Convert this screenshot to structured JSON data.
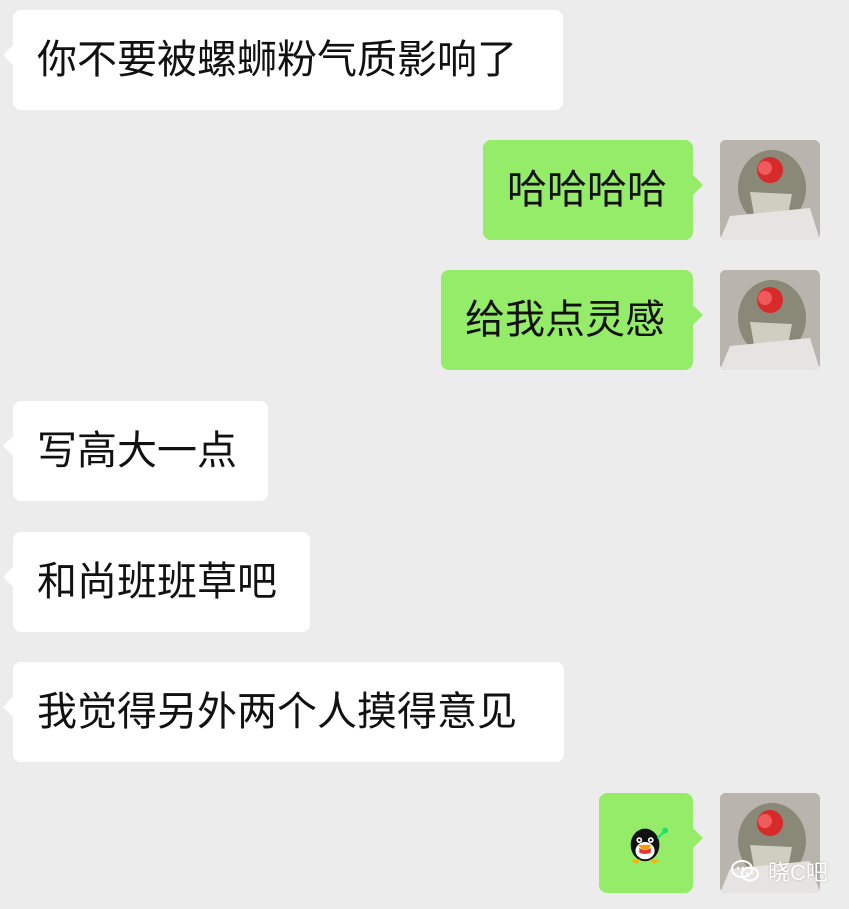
{
  "messages": [
    {
      "side": "left",
      "text": "你不要被螺蛳粉气质影响了"
    },
    {
      "side": "right",
      "text": "哈哈哈哈"
    },
    {
      "side": "right",
      "text": "给我点灵感"
    },
    {
      "side": "left",
      "text": "写高大一点"
    },
    {
      "side": "left",
      "text": "和尚班班草吧"
    },
    {
      "side": "left",
      "text": "我觉得另外两个人摸得意见"
    },
    {
      "side": "right",
      "sticker": "penguin-sticker"
    }
  ],
  "watermark": {
    "text": "晓C吧",
    "icon": "wechat-icon"
  },
  "colors": {
    "background": "#ececec",
    "incoming_bubble": "#ffffff",
    "outgoing_bubble": "#95ec69",
    "text": "#111111"
  }
}
